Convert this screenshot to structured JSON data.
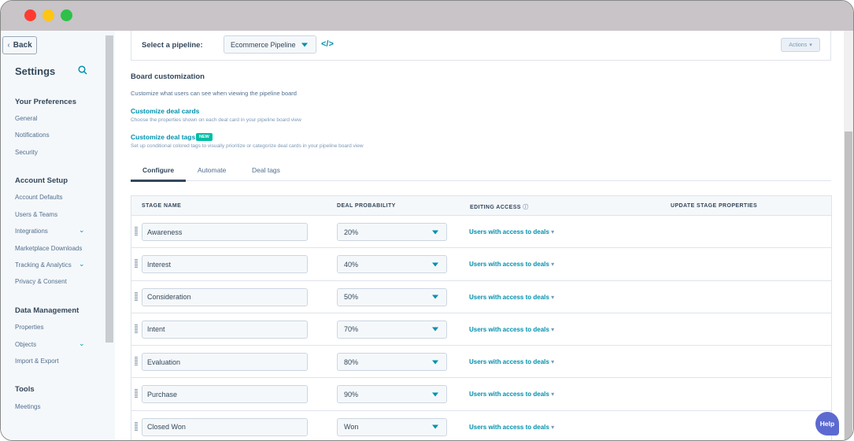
{
  "window": {
    "controls": [
      "close",
      "minimize",
      "maximize"
    ]
  },
  "sidebar": {
    "back": "Back",
    "title": "Settings",
    "sections": [
      {
        "heading": "Your Preferences",
        "items": [
          {
            "label": "General"
          },
          {
            "label": "Notifications"
          },
          {
            "label": "Security"
          }
        ]
      },
      {
        "heading": "Account Setup",
        "items": [
          {
            "label": "Account Defaults"
          },
          {
            "label": "Users & Teams"
          },
          {
            "label": "Integrations"
          },
          {
            "label": "Marketplace Downloads"
          },
          {
            "label": "Tracking & Analytics"
          },
          {
            "label": "Privacy & Consent"
          }
        ]
      },
      {
        "heading": "Data Management",
        "items": [
          {
            "label": "Properties"
          },
          {
            "label": "Objects"
          },
          {
            "label": "Import & Export"
          }
        ]
      },
      {
        "heading": "Tools",
        "items": [
          {
            "label": "Meetings"
          }
        ]
      }
    ]
  },
  "pipeline": {
    "label": "Select a pipeline:",
    "value": "Ecommerce Pipeline",
    "actions": "Actions"
  },
  "board": {
    "title": "Board customization",
    "desc": "Customize what users can see when viewing the pipeline board",
    "cards_link": "Customize deal cards",
    "cards_desc": "Choose the properties shown on each deal card in your pipeline board view",
    "tags_link": "Customize deal tags",
    "tags_badge": "NEW",
    "tags_desc": "Set up conditional colored tags to visually prioritize or categorize deal cards in your pipeline board view"
  },
  "tabs": [
    {
      "label": "Configure",
      "active": true
    },
    {
      "label": "Automate"
    },
    {
      "label": "Deal tags"
    }
  ],
  "table": {
    "headers": [
      "STAGE NAME",
      "DEAL PROBABILITY",
      "EDITING ACCESS",
      "UPDATE STAGE PROPERTIES"
    ],
    "rows": [
      {
        "name": "Awareness",
        "prob": "20%",
        "access": "Users with access to deals"
      },
      {
        "name": "Interest",
        "prob": "40%",
        "access": "Users with access to deals"
      },
      {
        "name": "Consideration",
        "prob": "50%",
        "access": "Users with access to deals"
      },
      {
        "name": "Intent",
        "prob": "70%",
        "access": "Users with access to deals"
      },
      {
        "name": "Evaluation",
        "prob": "80%",
        "access": "Users with access to deals"
      },
      {
        "name": "Purchase",
        "prob": "90%",
        "access": "Users with access to deals"
      },
      {
        "name": "Closed Won",
        "prob": "Won",
        "access": "Users with access to deals"
      }
    ]
  },
  "help": "Help",
  "colors": {
    "accent": "#0091ae",
    "badge": "#00bda5",
    "help": "#5c6ad0"
  }
}
